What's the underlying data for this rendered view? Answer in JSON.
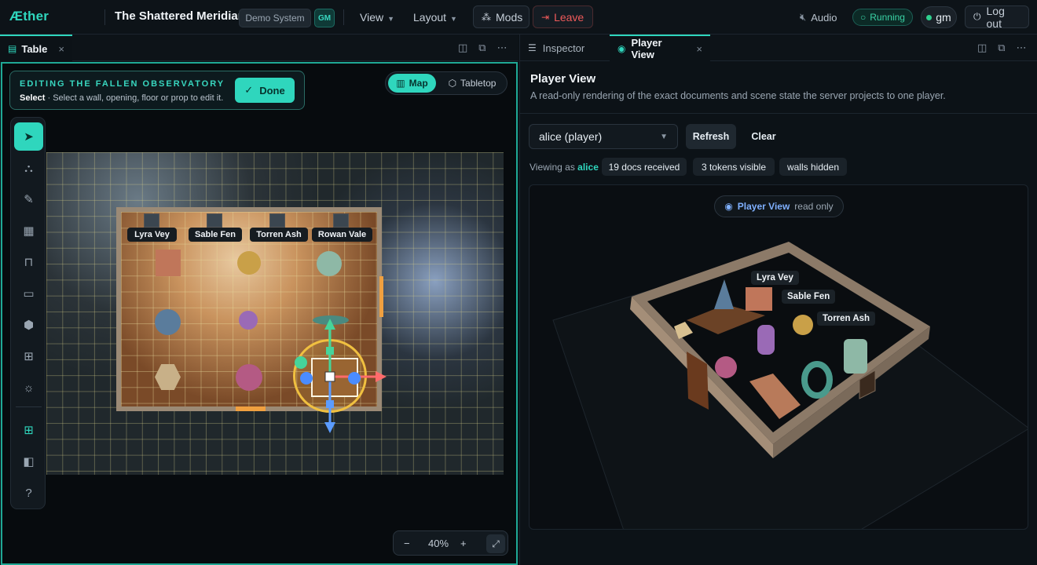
{
  "app": {
    "logo": "Æther",
    "title": "The Shattered Meridian",
    "system_badge": "Demo System",
    "role_badge": "GM"
  },
  "menus": {
    "view": "View",
    "layout": "Layout",
    "mods": "Mods",
    "leave": "Leave"
  },
  "status": {
    "audio": "Audio",
    "running": "Running",
    "user": "gm",
    "logout": "Log out"
  },
  "left_panel": {
    "tab": "Table",
    "edit_title": "EDITING THE FALLEN OBSERVATORY",
    "edit_mode": "Select",
    "edit_hint": " · Select a wall, opening, floor or prop to edit it.",
    "done": "Done",
    "mode_map": "Map",
    "mode_tabletop": "Tabletop",
    "tokens": [
      "Lyra Vey",
      "Sable Fen",
      "Torren Ash",
      "Rowan Vale"
    ],
    "zoom": "40%"
  },
  "right_panel": {
    "tabs": {
      "inspector": "Inspector",
      "player_view": "Player View"
    },
    "heading": "Player View",
    "description": "A read-only rendering of the exact documents and scene state the server projects to one player.",
    "player_select": "alice (player)",
    "refresh": "Refresh",
    "clear": "Clear",
    "viewing_prefix": "Viewing as",
    "viewing_user": "alice",
    "chips": [
      "19 docs received",
      "3 tokens visible",
      "walls hidden"
    ],
    "badge_title": "Player View",
    "badge_sub": "read only",
    "labels_3d": [
      "Lyra Vey",
      "Sable Fen",
      "Torren Ash"
    ]
  },
  "colors": {
    "accent": "#2fd6bd",
    "danger": "#f05a5a",
    "running": "#3ad3a6"
  }
}
